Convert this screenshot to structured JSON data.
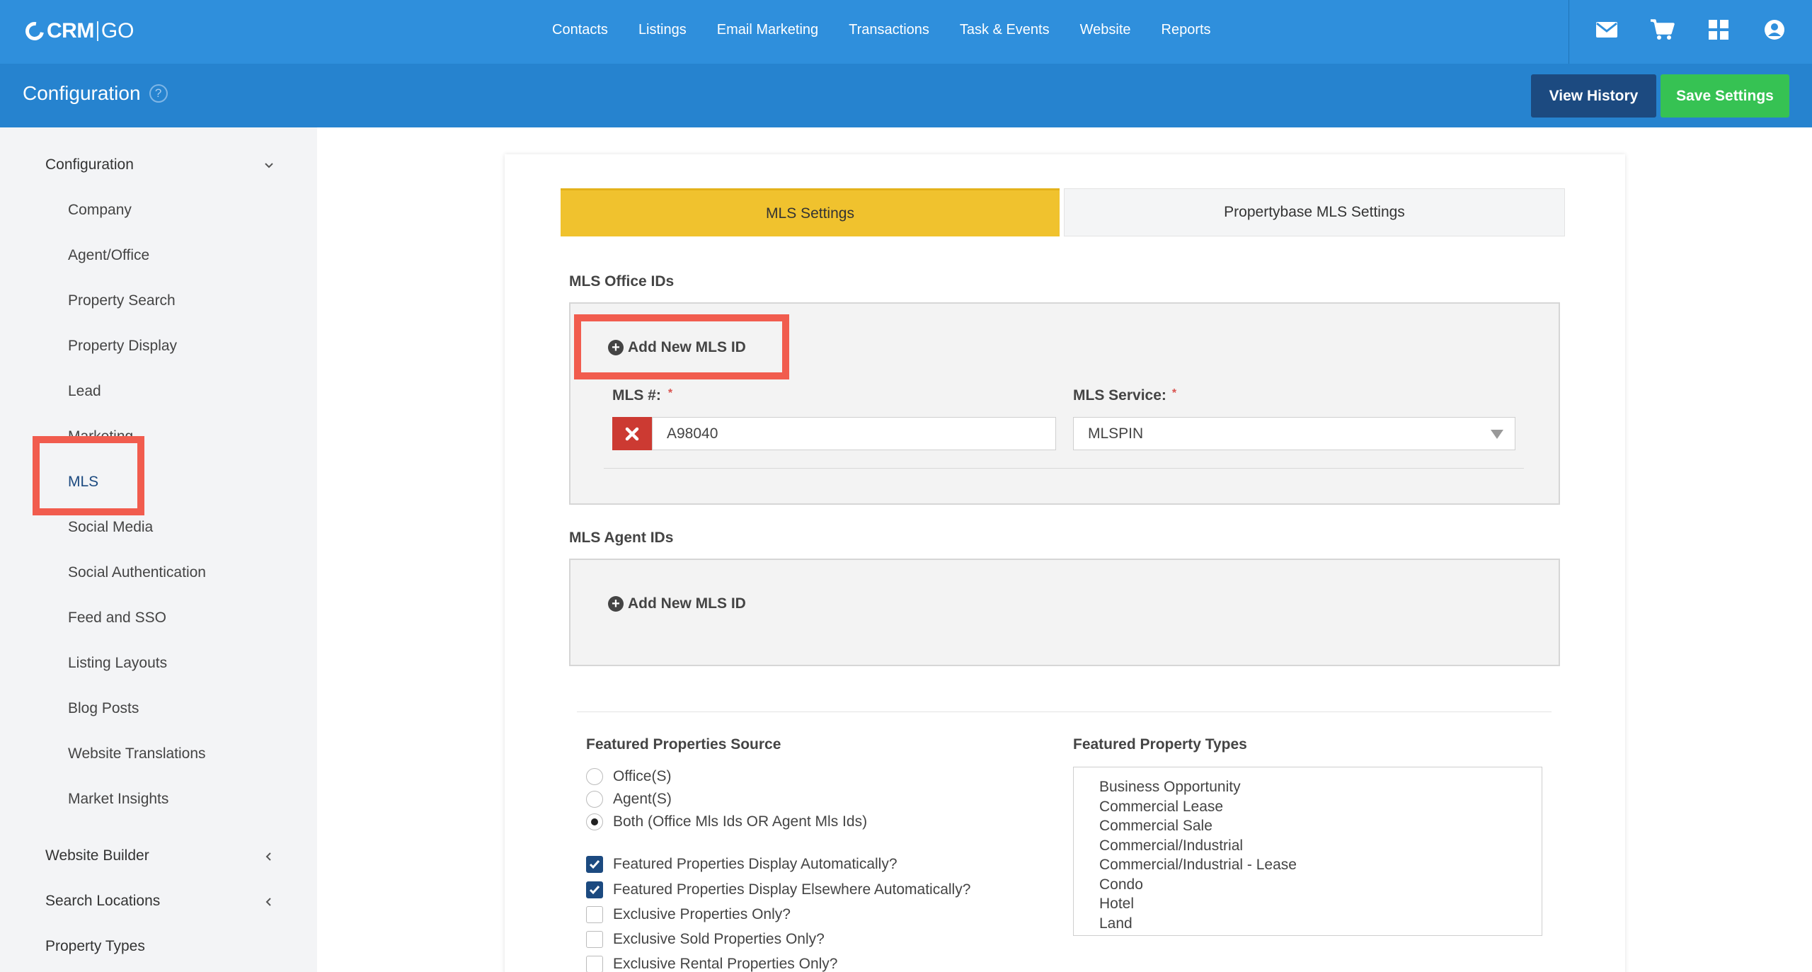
{
  "brand": {
    "crm": "CRM",
    "go": "GO"
  },
  "nav": [
    "Contacts",
    "Listings",
    "Email Marketing",
    "Transactions",
    "Task & Events",
    "Website",
    "Reports"
  ],
  "top_icons": [
    "mail-icon",
    "cart-icon",
    "grid-icon",
    "user-icon"
  ],
  "header": {
    "title": "Configuration",
    "help": "?",
    "view_history": "View History",
    "save_settings": "Save Settings"
  },
  "sidebar": {
    "configuration": "Configuration",
    "items": [
      "Company",
      "Agent/Office",
      "Property Search",
      "Property Display",
      "Lead",
      "Marketing",
      "MLS",
      "Social Media",
      "Social Authentication",
      "Feed and SSO",
      "Listing Layouts",
      "Blog Posts",
      "Website Translations",
      "Market Insights"
    ],
    "website_builder": "Website Builder",
    "search_locations": "Search Locations",
    "property_types": "Property Types"
  },
  "tabs": {
    "active": "MLS Settings",
    "inactive": "Propertybase MLS Settings"
  },
  "office_ids": {
    "label": "MLS Office IDs",
    "add": "Add New MLS ID",
    "mls_label": "MLS #:",
    "mls_value": "A98040",
    "service_label": "MLS Service:",
    "service_value": "MLSPIN",
    "required": "*"
  },
  "agent_ids": {
    "label": "MLS Agent IDs",
    "add": "Add New MLS ID"
  },
  "featured_source": {
    "label": "Featured Properties Source",
    "options": [
      "Office(S)",
      "Agent(S)",
      "Both (Office Mls Ids OR Agent Mls Ids)"
    ],
    "selected": "Both (Office Mls Ids OR Agent Mls Ids)"
  },
  "checkboxes": [
    {
      "label": "Featured Properties Display Automatically?",
      "checked": true
    },
    {
      "label": "Featured Properties Display Elsewhere Automatically?",
      "checked": true
    },
    {
      "label": "Exclusive Properties Only?",
      "checked": false
    },
    {
      "label": "Exclusive Sold Properties Only?",
      "checked": false
    },
    {
      "label": "Exclusive Rental Properties Only?",
      "checked": false
    }
  ],
  "featured_types": {
    "label": "Featured Property Types",
    "items": [
      "Business Opportunity",
      "Commercial Lease",
      "Commercial Sale",
      "Commercial/Industrial",
      "Commercial/Industrial - Lease",
      "Condo",
      "Hotel",
      "Land"
    ]
  },
  "colors": {
    "topbar": "#2f8fdc",
    "subbar": "#2683cf",
    "history": "#1c4a80",
    "save": "#36c253",
    "active_tab": "#f0c22e",
    "highlight": "#f15c4e"
  }
}
